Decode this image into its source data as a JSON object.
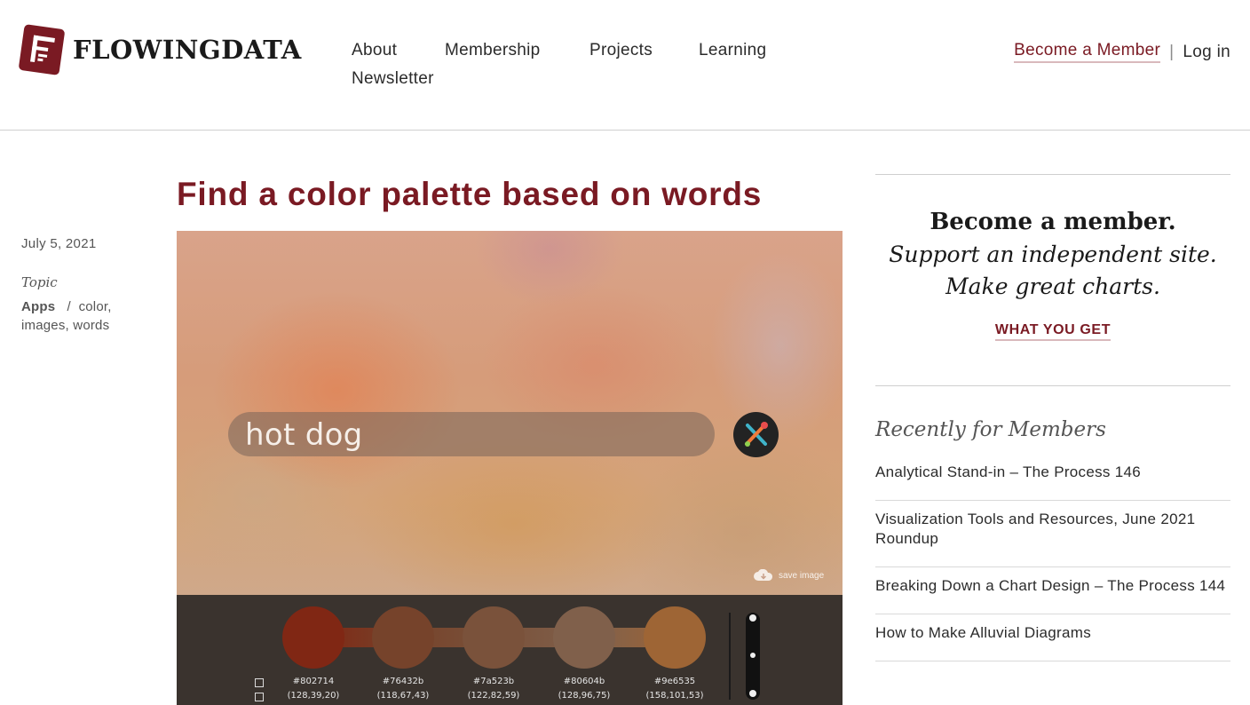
{
  "header": {
    "logo_text": "FLOWINGDATA",
    "nav": [
      "About",
      "Membership",
      "Projects",
      "Learning",
      "Newsletter"
    ],
    "become_member": "Become a Member",
    "separator": "|",
    "login": "Log in"
  },
  "article": {
    "title": "Find a color palette based on words",
    "date": "July 5, 2021",
    "topic_label": "Topic",
    "category": "Apps",
    "topic_separator": "/",
    "tags_line1": "color,",
    "tags_line2": "images, words"
  },
  "app_screenshot": {
    "query": "hot dog",
    "save_image_label": "save image",
    "swatches": [
      {
        "hex": "#802714",
        "rgb": "(128,39,20)"
      },
      {
        "hex": "#76432b",
        "rgb": "(118,67,43)"
      },
      {
        "hex": "#7a523b",
        "rgb": "(122,82,59)"
      },
      {
        "hex": "#80604b",
        "rgb": "(128,96,75)"
      },
      {
        "hex": "#9e6535",
        "rgb": "(158,101,53)"
      }
    ]
  },
  "sidebar": {
    "promo_heading": "Become a member.",
    "promo_line1": "Support an independent site.",
    "promo_line2": "Make great charts.",
    "promo_cta": "WHAT YOU GET",
    "recent_heading": "Recently for Members",
    "recent_items": [
      "Analytical Stand-in – The Process 146",
      "Visualization Tools and Resources, June 2021 Roundup",
      "Breaking Down a Chart Design – The Process 144",
      "How to Make Alluvial Diagrams"
    ]
  },
  "colors": {
    "brand": "#7a1a23",
    "text": "#2b2b2b"
  }
}
